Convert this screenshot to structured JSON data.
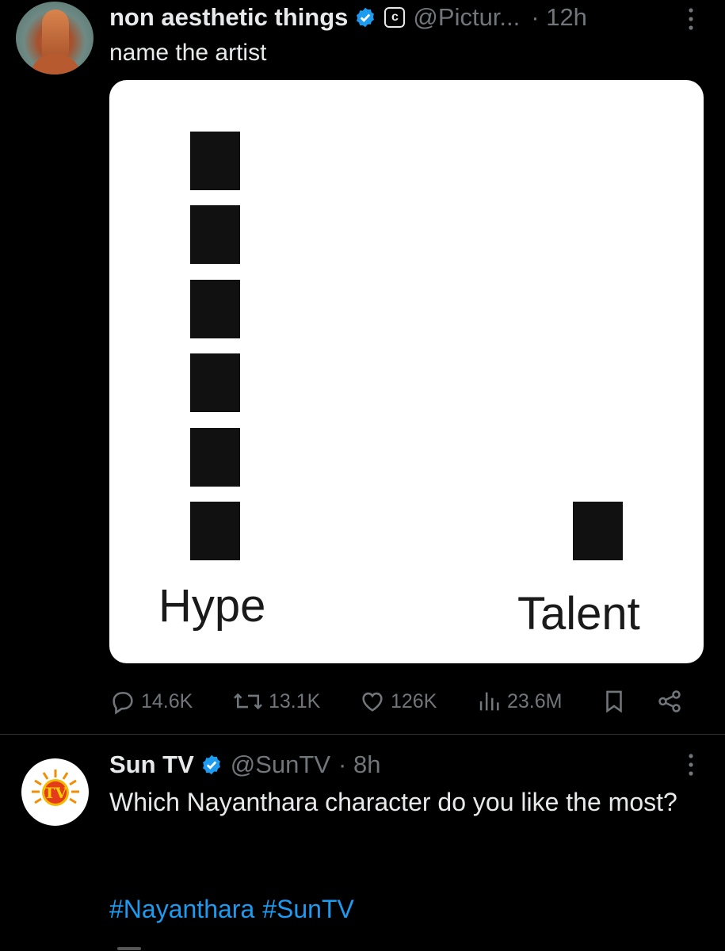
{
  "tweet1": {
    "author_name": "non aesthetic things",
    "handle": "@Pictur...",
    "time": "· 12h",
    "text": "name the artist",
    "affiliate_badge_glyph": "c",
    "stats": {
      "replies": "14.6K",
      "retweets": "13.1K",
      "likes": "126K",
      "views": "23.6M"
    }
  },
  "chart_data": {
    "type": "bar",
    "categories": [
      "Hype",
      "Talent"
    ],
    "values": [
      6,
      1
    ],
    "ylim": [
      0,
      6
    ],
    "style": "stacked square blocks, black on white"
  },
  "tweet2": {
    "author_name": "Sun TV",
    "handle": "@SunTV",
    "time": "· 8h",
    "text": "Which Nayanthara character do you like the most?",
    "hashtags": [
      "#Nayanthara",
      "#SunTV"
    ],
    "avatar_logo_text": "TV"
  },
  "colors": {
    "background": "#000000",
    "text_primary": "#e7e9ea",
    "text_secondary": "#71767b",
    "accent": "#1d9bf0",
    "divider": "#2f3336"
  },
  "icons": {
    "reply": "reply-icon",
    "retweet": "retweet-icon",
    "like": "heart-icon",
    "views": "views-icon",
    "bookmark": "bookmark-icon",
    "share": "share-icon",
    "more": "more-icon",
    "verified": "verified-badge-icon"
  }
}
